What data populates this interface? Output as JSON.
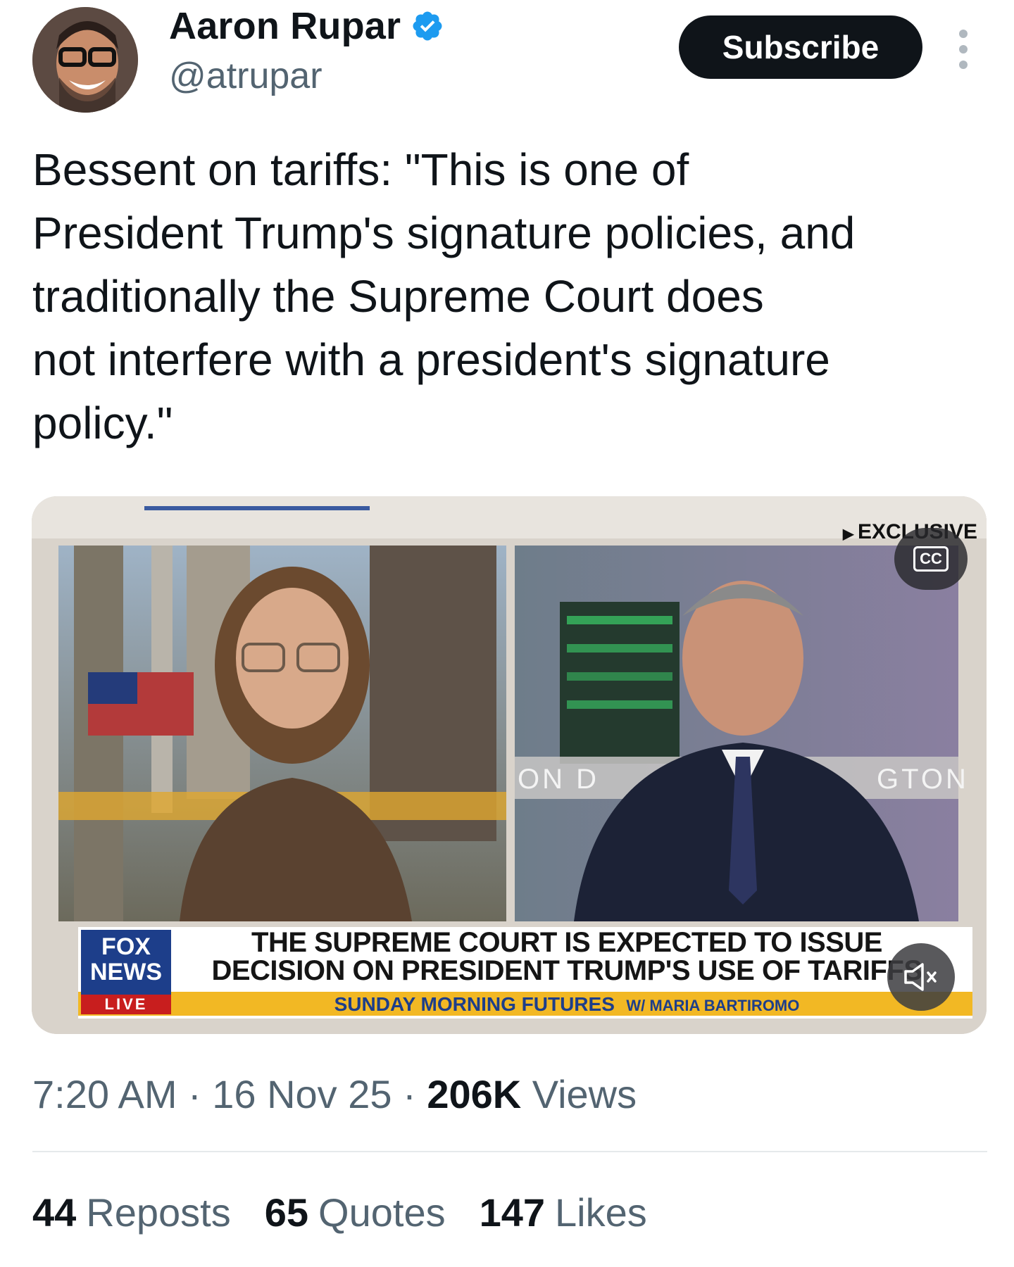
{
  "author": {
    "display_name": "Aaron Rupar",
    "handle": "@atrupar",
    "verified": true
  },
  "actions": {
    "subscribe_label": "Subscribe",
    "more_icon": "more-vertical-icon"
  },
  "tweet": {
    "text": "Bessent on tariffs: \"This is one of\nPresident Trump's signature policies, and\ntraditionally the Supreme Court does\nnot interfere with a president's signature\npolicy.\""
  },
  "media": {
    "exclusive_label": "EXCLUSIVE",
    "cc_label": "CC",
    "chyron_line1": "THE SUPREME COURT IS EXPECTED TO ISSUE",
    "chyron_line2": "DECISION ON PRESIDENT TRUMP'S USE OF TARIFFS",
    "show_name": "SUNDAY MORNING FUTURES",
    "host_tag": "W/ MARIA BARTIROMO",
    "network_line1": "FOX",
    "network_line2": "NEWS",
    "network_live": "LIVE",
    "backdrop_left": "ON D",
    "backdrop_right": "GTON",
    "mute_icon": "volume-muted-icon"
  },
  "meta": {
    "time": "7:20 AM",
    "date": "16 Nov 25",
    "views_count": "206K",
    "views_label": "Views",
    "separator": "·"
  },
  "stats": {
    "reposts_count": "44",
    "reposts_label": "Reposts",
    "quotes_count": "65",
    "quotes_label": "Quotes",
    "likes_count": "147",
    "likes_label": "Likes"
  },
  "colors": {
    "verified_blue": "#1d9bf0",
    "button_dark": "#0f1419",
    "secondary_text": "#536471",
    "fox_blue": "#1d3e8a",
    "chyron_yellow": "#f2b824"
  }
}
